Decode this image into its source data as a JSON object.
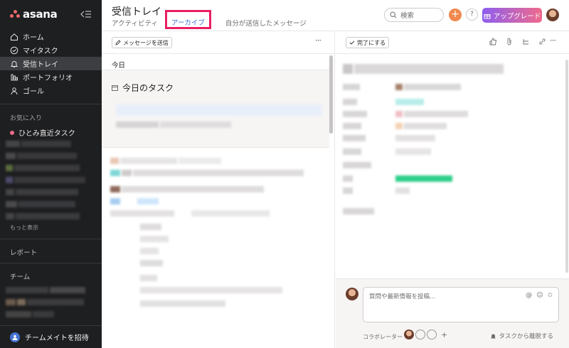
{
  "app": {
    "logo_text": "asana"
  },
  "sidebar": {
    "nav": [
      {
        "label": "ホーム",
        "icon": "home-icon"
      },
      {
        "label": "マイタスク",
        "icon": "check-circle-icon"
      },
      {
        "label": "受信トレイ",
        "icon": "bell-icon",
        "active": true
      },
      {
        "label": "ポートフォリオ",
        "icon": "bar-chart-icon"
      },
      {
        "label": "ゴール",
        "icon": "person-icon"
      }
    ],
    "favorites_label": "お気に入り",
    "favorite_item": "ひとみ直近タスク",
    "more_label": "もっと表示",
    "reports_label": "レポート",
    "team_label": "チーム",
    "invite_label": "チームメイトを招待"
  },
  "header": {
    "title": "受信トレイ",
    "tabs": {
      "activity": "アクティビティ",
      "archive": "アーカイブ",
      "sent": "自分が送信したメッセージ"
    },
    "search_placeholder": "検索",
    "plus_label": "+",
    "help_label": "?",
    "upgrade_label": "アップグレード"
  },
  "left_pane": {
    "send_message_label": "メッセージを送信",
    "more_label": "···",
    "today_label": "今日",
    "task_card_title": "今日のタスク"
  },
  "right_pane": {
    "complete_label": "完了にする",
    "more_label": "···",
    "comment_placeholder": "質問や最新情報を投稿...",
    "collaborators_label": "コラボレーター",
    "add_collaborator_label": "+",
    "leave_task_label": "タスクから離脱する"
  },
  "colors": {
    "sidebar_bg": "#1e1f21",
    "highlight": "#e91e63",
    "accent": "#4573d2",
    "upgrade_from": "#8d5ef0",
    "upgrade_to": "#f06a8b"
  }
}
